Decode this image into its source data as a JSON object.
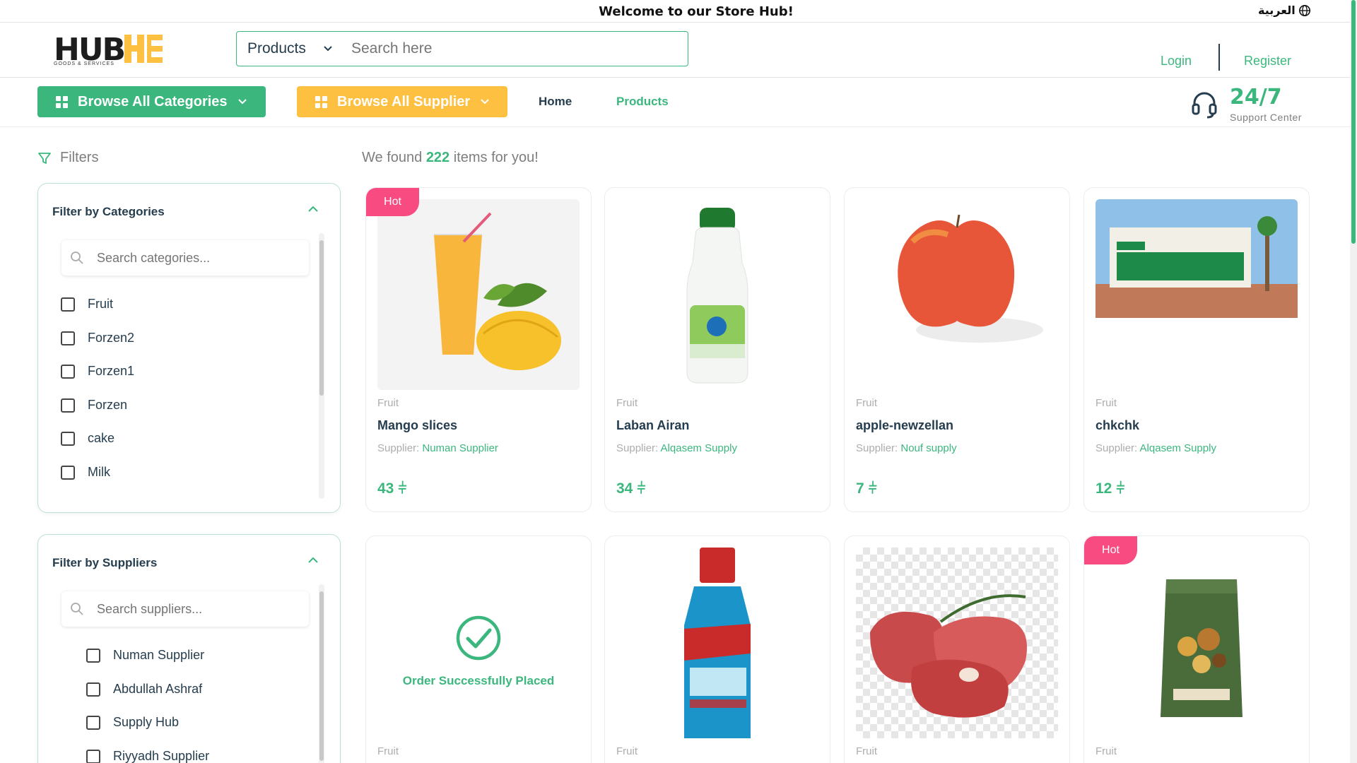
{
  "topbar": {
    "welcome": "Welcome to our Store Hub!",
    "language": "العربية",
    "globe_icon": "globe-icon"
  },
  "header": {
    "logo_text": "HUB",
    "logo_tagline": "GOODS & SERVICES",
    "search_category": "Products",
    "search_placeholder": "Search here",
    "login": "Login",
    "register": "Register"
  },
  "nav": {
    "browse_categories": "Browse All Categories",
    "browse_suppliers": "Browse All Supplier",
    "home": "Home",
    "products": "Products",
    "support_big": "24/7",
    "support_small": "Support Center"
  },
  "filters": {
    "title": "Filters",
    "categories": {
      "title": "Filter by Categories",
      "search_placeholder": "Search categories...",
      "items": [
        "Fruit",
        "Forzen2",
        "Forzen1",
        "Forzen",
        "cake",
        "Milk"
      ]
    },
    "suppliers": {
      "title": "Filter by Suppliers",
      "search_placeholder": "Search suppliers...",
      "items": [
        "Numan Supplier",
        "Abdullah Ashraf",
        "Supply Hub",
        "Riyyadh Supplier"
      ]
    }
  },
  "results": {
    "prefix": "We found",
    "count": "222",
    "suffix": "items for you!",
    "supplier_label": "Supplier:",
    "currency_icon": "riyal-icon",
    "hot_label": "Hot",
    "order_success": "Order Successfully Placed",
    "products": [
      {
        "category": "Fruit",
        "name": "Mango slices",
        "supplier": "Numan Supplier",
        "price": "43",
        "hot": true
      },
      {
        "category": "Fruit",
        "name": "Laban Airan",
        "supplier": "Alqasem Supply",
        "price": "34",
        "hot": false
      },
      {
        "category": "Fruit",
        "name": "apple-newzellan",
        "supplier": "Nouf supply",
        "price": "7",
        "hot": false
      },
      {
        "category": "Fruit",
        "name": "chkchk",
        "supplier": "Alqasem Supply",
        "price": "12",
        "hot": false
      },
      {
        "category": "Fruit",
        "hot": false
      },
      {
        "category": "Fruit",
        "hot": false
      },
      {
        "category": "Fruit",
        "hot": false
      },
      {
        "category": "Fruit",
        "hot": true
      }
    ]
  },
  "colors": {
    "accent": "#3bb77e",
    "brand_yellow": "#fdc040",
    "hot": "#f74b81",
    "text": "#253d4e"
  }
}
